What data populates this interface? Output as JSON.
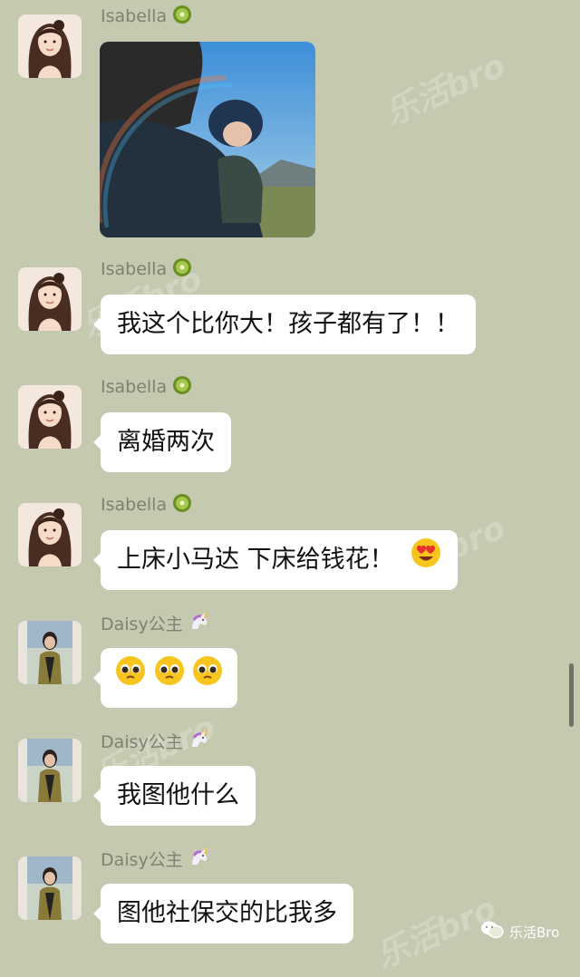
{
  "messages": [
    {
      "sender": "Isabella",
      "sender_badge": "kiwi-icon",
      "type": "image",
      "image_desc": "woman-holding-baby-photo"
    },
    {
      "sender": "Isabella",
      "sender_badge": "kiwi-icon",
      "type": "text",
      "text": "我这个比你大！孩子都有了！！"
    },
    {
      "sender": "Isabella",
      "sender_badge": "kiwi-icon",
      "type": "text",
      "text": "离婚两次"
    },
    {
      "sender": "Isabella",
      "sender_badge": "kiwi-icon",
      "type": "text",
      "text": "上床小马达 下床给钱花！",
      "trailing_emoji": "heart-eyes-emoji"
    },
    {
      "sender": "Daisy公主",
      "sender_badge": "unicorn-icon",
      "type": "emoji",
      "emojis": [
        "pleading-face-emoji",
        "pleading-face-emoji",
        "pleading-face-emoji"
      ]
    },
    {
      "sender": "Daisy公主",
      "sender_badge": "unicorn-icon",
      "type": "text",
      "text": "我图他什么"
    },
    {
      "sender": "Daisy公主",
      "sender_badge": "unicorn-icon",
      "type": "text",
      "text": "图他社保交的比我多"
    }
  ],
  "watermark": {
    "text": "乐活bro"
  },
  "brand": {
    "label": "乐活Bro",
    "icon": "wechat-icon"
  },
  "colors": {
    "background": "#c4c9b0",
    "bubble": "#ffffff",
    "sender_text": "#7d8272"
  }
}
